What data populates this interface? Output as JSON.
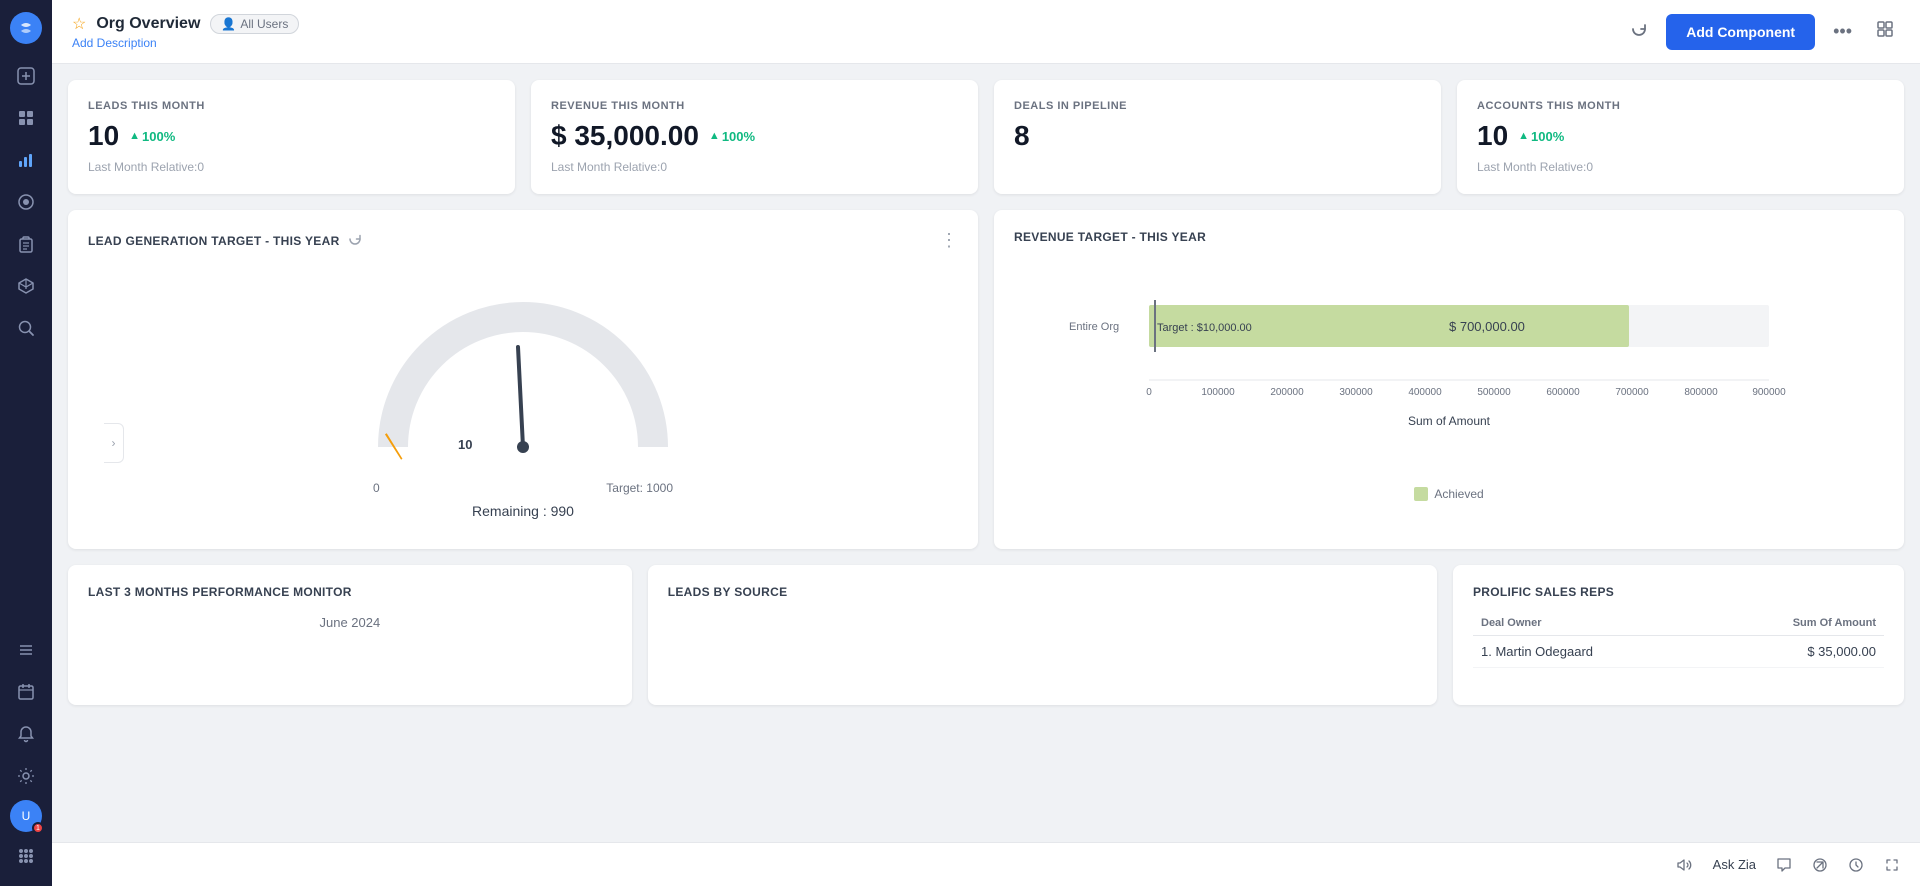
{
  "sidebar": {
    "logo": "Z",
    "icons": [
      {
        "name": "add-icon",
        "symbol": "+",
        "active": false
      },
      {
        "name": "home-icon",
        "symbol": "⊞",
        "active": false
      },
      {
        "name": "chart-icon",
        "symbol": "📊",
        "active": true
      },
      {
        "name": "circle-icon",
        "symbol": "◎",
        "active": false
      },
      {
        "name": "clipboard-icon",
        "symbol": "📋",
        "active": false
      },
      {
        "name": "box-icon",
        "symbol": "📦",
        "active": false
      },
      {
        "name": "search-icon",
        "symbol": "🔍",
        "active": false
      }
    ],
    "bottom_icons": [
      {
        "name": "list-icon",
        "symbol": "☰"
      },
      {
        "name": "calendar-icon",
        "symbol": "📅"
      },
      {
        "name": "bell-icon",
        "symbol": "🔔"
      },
      {
        "name": "settings-icon",
        "symbol": "⚙"
      }
    ],
    "avatar_initials": "U",
    "grid-icon": "⊞"
  },
  "topbar": {
    "title": "Org Overview",
    "badge": "All Users",
    "add_description": "Add Description",
    "add_component_label": "Add Component",
    "refresh_title": "Refresh",
    "more_title": "More options",
    "layout_title": "Layout"
  },
  "kpi_cards": [
    {
      "label": "LEADS THIS MONTH",
      "value": "10",
      "change": "100%",
      "sub": "Last Month Relative:0"
    },
    {
      "label": "REVENUE THIS MONTH",
      "value": "$ 35,000.00",
      "change": "100%",
      "sub": "Last Month Relative:0"
    },
    {
      "label": "DEALS IN PIPELINE",
      "value": "8",
      "change": "",
      "sub": ""
    },
    {
      "label": "ACCOUNTS THIS MONTH",
      "value": "10",
      "change": "100%",
      "sub": "Last Month Relative:0"
    }
  ],
  "lead_target": {
    "title": "LEAD GENERATION TARGET - THIS YEAR",
    "value": 10,
    "target": 1000,
    "remaining_label": "Remaining : 990",
    "target_label": "Target: 1000",
    "zero_label": "0",
    "ten_label": "10"
  },
  "revenue_target": {
    "title": "REVENUE TARGET - THIS YEAR",
    "bar_label": "Entire Org",
    "target_text": "Target : $10,000.00",
    "achieved_text": "$ 700,000.00",
    "x_axis": [
      "0",
      "100000",
      "200000",
      "300000",
      "400000",
      "500000",
      "600000",
      "700000",
      "800000",
      "900000"
    ],
    "y_axis_label": "Sum of Amount",
    "legend_achieved": "Achieved",
    "legend_color": "#a8c66e"
  },
  "performance_monitor": {
    "title": "LAST 3 MONTHS PERFORMANCE MONITOR",
    "period": "June 2024"
  },
  "leads_by_source": {
    "title": "LEADS BY SOURCE"
  },
  "prolific_reps": {
    "title": "PROLIFIC SALES REPS",
    "col_owner": "Deal Owner",
    "col_amount": "Sum Of Amount",
    "rows": [
      {
        "owner": "1. Martin Odegaard",
        "amount": "$ 35,000.00"
      }
    ]
  },
  "bottom_toolbar": {
    "ask_zia": "Ask Zia"
  }
}
